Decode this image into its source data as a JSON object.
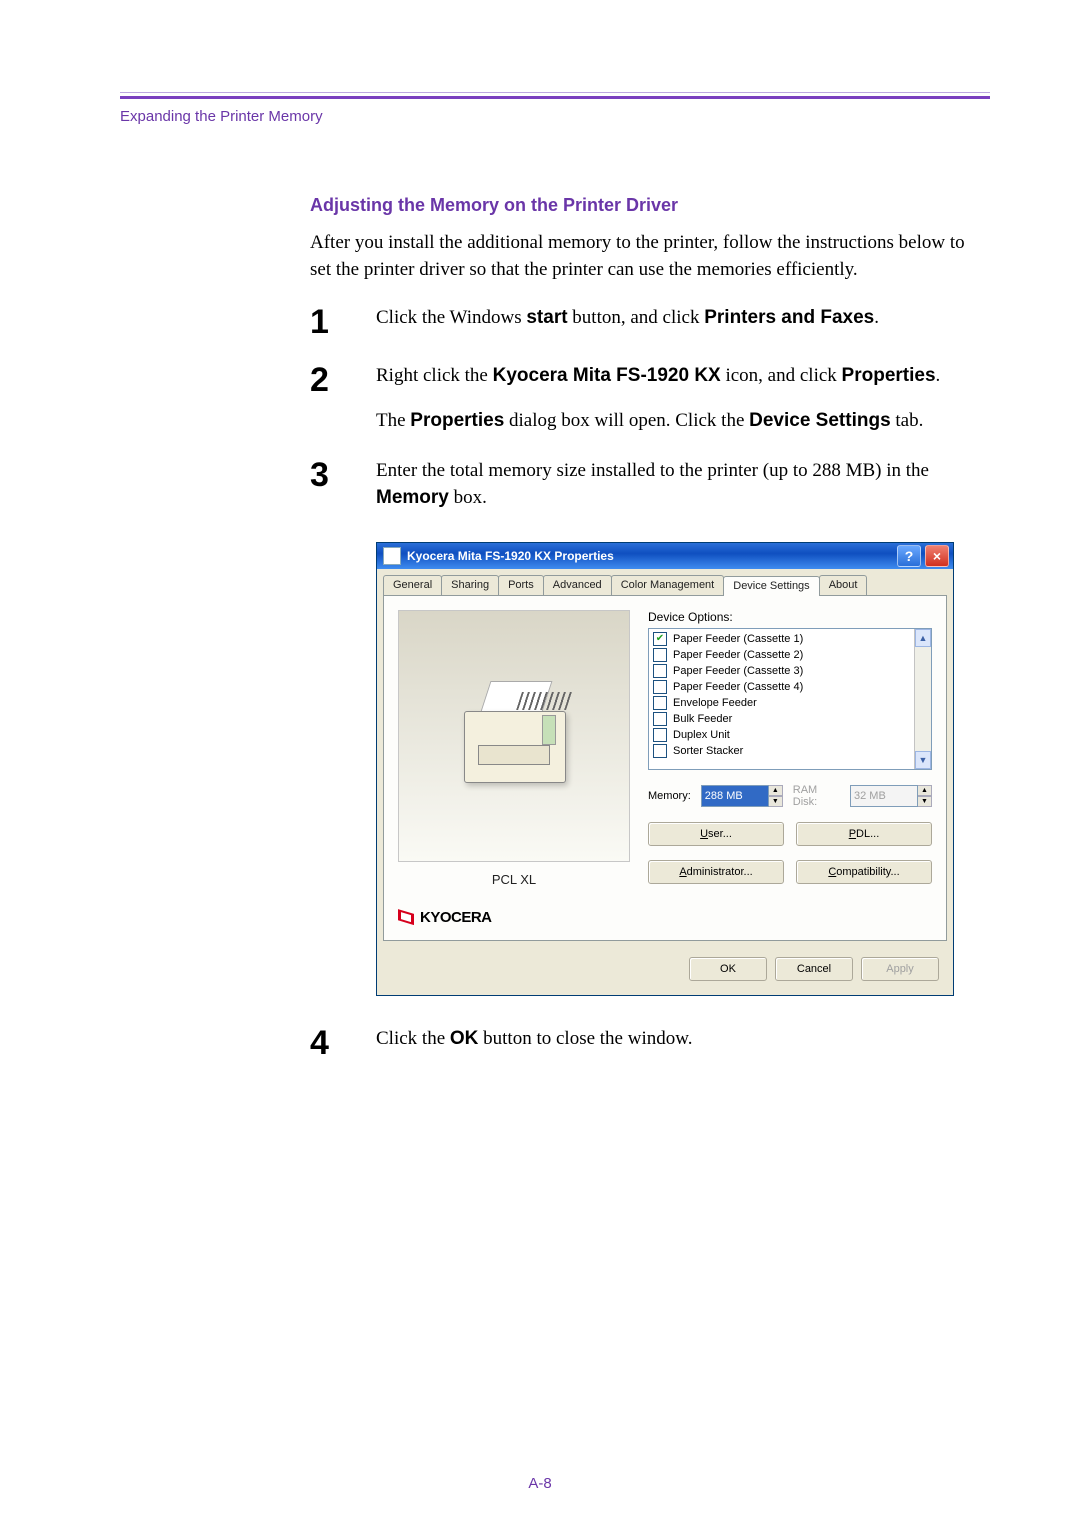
{
  "header": {
    "breadcrumb": "Expanding the Printer Memory"
  },
  "section": {
    "title": "Adjusting the Memory on the Printer Driver",
    "intro": "After you install the additional memory to the printer, follow the instructions below to set the printer driver so that the printer can use the memories efficiently."
  },
  "steps": {
    "s1": {
      "num": "1",
      "a": "Click the Windows ",
      "b": "start",
      "c": " button, and click ",
      "d": "Printers and Faxes",
      "e": "."
    },
    "s2": {
      "num": "2",
      "p1a": "Right click the ",
      "p1b": "Kyocera Mita FS-1920 KX",
      "p1c": " icon, and click ",
      "p1d": "Properties",
      "p1e": ".",
      "p2a": "The ",
      "p2b": "Properties",
      "p2c": " dialog box will open. Click the ",
      "p2d": "Device Settings",
      "p2e": " tab."
    },
    "s3": {
      "num": "3",
      "a": "Enter the total memory size installed to the printer (up to 288 MB) in the ",
      "b": "Memory",
      "c": " box."
    },
    "s4": {
      "num": "4",
      "a": "Click the ",
      "b": "OK",
      "c": " button to close the window."
    }
  },
  "dialog": {
    "title": "Kyocera Mita FS-1920 KX Properties",
    "help": "?",
    "close": "×",
    "tabs": [
      "General",
      "Sharing",
      "Ports",
      "Advanced",
      "Color Management",
      "Device Settings",
      "About"
    ],
    "active_tab": "Device Settings",
    "pcl_label": "PCL XL",
    "logo_text": "KYOCERA",
    "device_options_label": "Device Options:",
    "options": [
      {
        "label": "Paper Feeder (Cassette 1)",
        "checked": true
      },
      {
        "label": "Paper Feeder (Cassette 2)",
        "checked": false
      },
      {
        "label": "Paper Feeder (Cassette 3)",
        "checked": false
      },
      {
        "label": "Paper Feeder (Cassette 4)",
        "checked": false
      },
      {
        "label": "Envelope Feeder",
        "checked": false
      },
      {
        "label": "Bulk Feeder",
        "checked": false
      },
      {
        "label": "Duplex Unit",
        "checked": false
      },
      {
        "label": "Sorter Stacker",
        "checked": false
      }
    ],
    "memory_label": "Memory:",
    "memory_value": "288 MB",
    "ramdisk_label": "RAM Disk:",
    "ramdisk_value": "32 MB",
    "buttons": {
      "user": "User...",
      "pdl": "PDL...",
      "admin": "Administrator...",
      "compat": "Compatibility..."
    },
    "footer": {
      "ok": "OK",
      "cancel": "Cancel",
      "apply": "Apply"
    }
  },
  "page_number": "A-8"
}
